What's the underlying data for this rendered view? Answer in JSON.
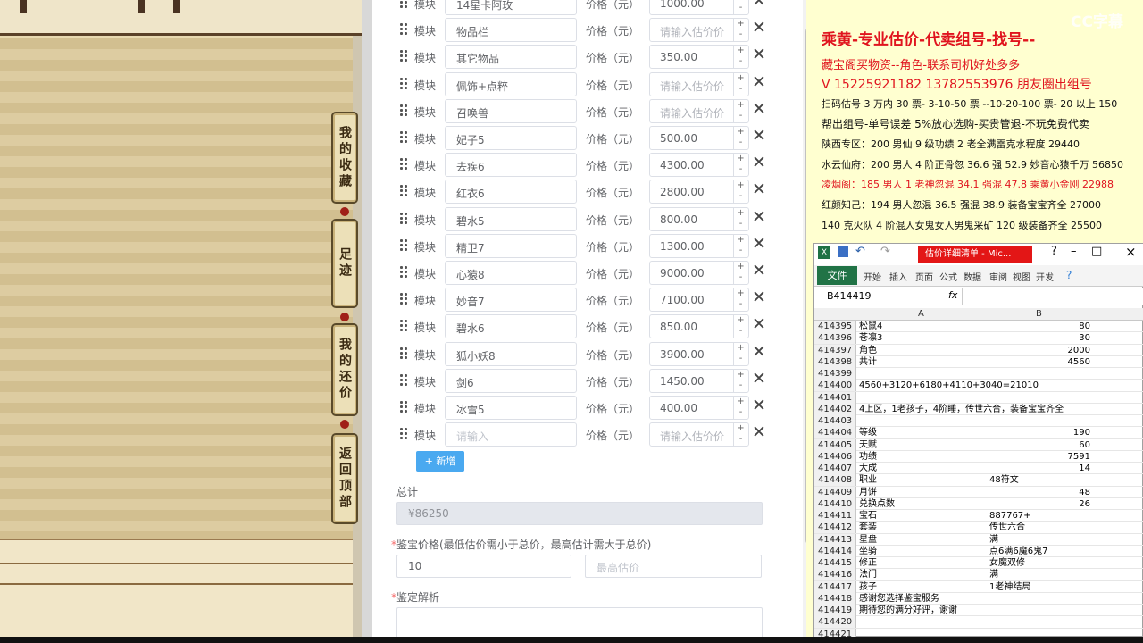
{
  "left_panel": {
    "side_buttons": [
      "我的收藏",
      "足迹",
      "我的还价",
      "返回顶部"
    ]
  },
  "form": {
    "module_label": "模块",
    "price_label": "价格（元）",
    "rows": [
      {
        "name": "14星卡阿玫",
        "price": "1000.00",
        "name_ph": false,
        "price_ph": false
      },
      {
        "name": "物品栏",
        "price": "请输入估价价",
        "name_ph": false,
        "price_ph": true
      },
      {
        "name": "其它物品",
        "price": "350.00",
        "name_ph": false,
        "price_ph": false
      },
      {
        "name": "佩饰+点粹",
        "price": "请输入估价价",
        "name_ph": false,
        "price_ph": true
      },
      {
        "name": "召唤兽",
        "price": "请输入估价价",
        "name_ph": false,
        "price_ph": true
      },
      {
        "name": "妃子5",
        "price": "500.00",
        "name_ph": false,
        "price_ph": false
      },
      {
        "name": "去疾6",
        "price": "4300.00",
        "name_ph": false,
        "price_ph": false
      },
      {
        "name": "红衣6",
        "price": "2800.00",
        "name_ph": false,
        "price_ph": false
      },
      {
        "name": "碧水5",
        "price": "800.00",
        "name_ph": false,
        "price_ph": false
      },
      {
        "name": "精卫7",
        "price": "1300.00",
        "name_ph": false,
        "price_ph": false
      },
      {
        "name": "心猿8",
        "price": "9000.00",
        "name_ph": false,
        "price_ph": false
      },
      {
        "name": "妙音7",
        "price": "7100.00",
        "name_ph": false,
        "price_ph": false
      },
      {
        "name": "碧水6",
        "price": "850.00",
        "name_ph": false,
        "price_ph": false
      },
      {
        "name": "狐小妖8",
        "price": "3900.00",
        "name_ph": false,
        "price_ph": false
      },
      {
        "name": "剑6",
        "price": "1450.00",
        "name_ph": false,
        "price_ph": false
      },
      {
        "name": "冰雪5",
        "price": "400.00",
        "name_ph": false,
        "price_ph": false
      },
      {
        "name": "请输入",
        "price": "请输入估价价",
        "name_ph": true,
        "price_ph": true
      }
    ],
    "add_button": "+ 新增",
    "total_label": "总计",
    "total_value": "¥86250",
    "appraise_label": "鉴宝价格(最低估价需小于总价，最高估计需大于总价)",
    "min_value": "10",
    "max_placeholder": "最高估价",
    "analysis_label": "鉴定解析",
    "req_mark": "*"
  },
  "notes": {
    "watermark": "CC字幕",
    "lines": [
      {
        "text": "乘黄-专业估价-代卖组号-找号--",
        "red": true,
        "size": 17
      },
      {
        "text": "藏宝阁买物资--角色-联系司机好处多多",
        "red": true,
        "size": 13
      },
      {
        "text": "V 15225921182   13782553976 朋友圈出组号",
        "red": true,
        "size": 14
      },
      {
        "text": "扫码估号 3 万内 30 票- 3-10-50 票  --10-20-100 票- 20 以上 150",
        "red": false,
        "size": 11
      },
      {
        "text": "帮出组号-单号误差 5%放心选购-买贵管退-不玩免费代卖",
        "red": false,
        "size": 12
      },
      {
        "text": "陕西专区：200 男仙 9 级功绩 2 老全满雷克水程度 29440",
        "red": false,
        "size": 11
      },
      {
        "text": "水云仙府：200 男人 4 阶正骨忽 36.6 强 52.9 妙音心猿千万 56850",
        "red": false,
        "size": 11
      },
      {
        "text": "凌烟阁：185 男人 1 老神忽混 34.1 强混 47.8 乘黄小金刚 22988",
        "red": true,
        "size": 11
      },
      {
        "text": "红颜知己：194 男人忽混 36.5 强混 38.9 装备宝宝齐全 27000",
        "red": false,
        "size": 11
      },
      {
        "text": "140 克火队 4 阶混人女鬼女人男鬼采矿 120 级装备齐全 25500",
        "red": false,
        "size": 11
      }
    ]
  },
  "excel": {
    "title": "估价详细清单 - Mic...",
    "file_tab": "文件",
    "ribbon_tabs": [
      "开始",
      "插入",
      "页面",
      "公式",
      "数据",
      "审阅",
      "视图",
      "开发"
    ],
    "name_box": "B414419",
    "fx": "fx",
    "col_a": "A",
    "col_b": "B",
    "rows": [
      {
        "n": "414395",
        "a": "松鼠4",
        "b": "80",
        "num": true
      },
      {
        "n": "414396",
        "a": "苍凛3",
        "b": "30",
        "num": true
      },
      {
        "n": "414397",
        "a": "角色",
        "b": "2000",
        "num": true
      },
      {
        "n": "414398",
        "a": "共计",
        "b": "4560",
        "num": true
      },
      {
        "n": "414399",
        "a": "",
        "b": "",
        "num": false
      },
      {
        "n": "414400",
        "a": "4560+3120+6180+4110+3040=21010",
        "b": "",
        "num": false
      },
      {
        "n": "414401",
        "a": "",
        "b": "",
        "num": false
      },
      {
        "n": "414402",
        "a": "4上区，1老孩子，4阶睡，传世六合，装备宝宝齐全",
        "b": "",
        "num": false
      },
      {
        "n": "414403",
        "a": "",
        "b": "",
        "num": false
      },
      {
        "n": "414404",
        "a": "等级",
        "b": "190",
        "num": true
      },
      {
        "n": "414405",
        "a": "天赋",
        "b": "60",
        "num": true
      },
      {
        "n": "414406",
        "a": "功绩",
        "b": "7591",
        "num": true
      },
      {
        "n": "414407",
        "a": "大成",
        "b": "14",
        "num": true
      },
      {
        "n": "414408",
        "a": "职业",
        "b": "48符文",
        "num": false
      },
      {
        "n": "414409",
        "a": "月饼",
        "b": "48",
        "num": true
      },
      {
        "n": "414410",
        "a": "兑换点数",
        "b": "26",
        "num": true
      },
      {
        "n": "414411",
        "a": "宝石",
        "b": "887767+",
        "num": false
      },
      {
        "n": "414412",
        "a": "套装",
        "b": "传世六合",
        "num": false
      },
      {
        "n": "414413",
        "a": "星盘",
        "b": "满",
        "num": false
      },
      {
        "n": "414414",
        "a": "坐骑",
        "b": "点6满6魔6鬼7",
        "num": false
      },
      {
        "n": "414415",
        "a": "修正",
        "b": "女魔双修",
        "num": false
      },
      {
        "n": "414416",
        "a": "法门",
        "b": "满",
        "num": false
      },
      {
        "n": "414417",
        "a": "孩子",
        "b": "1老神结局",
        "num": false
      },
      {
        "n": "414418",
        "a": "感谢您选择鉴宝服务",
        "b": "",
        "num": false
      },
      {
        "n": "414419",
        "a": "期待您的满分好评，谢谢",
        "b": "",
        "num": false
      },
      {
        "n": "414420",
        "a": "",
        "b": "",
        "num": false
      },
      {
        "n": "414421",
        "a": "",
        "b": "",
        "num": false
      }
    ]
  }
}
